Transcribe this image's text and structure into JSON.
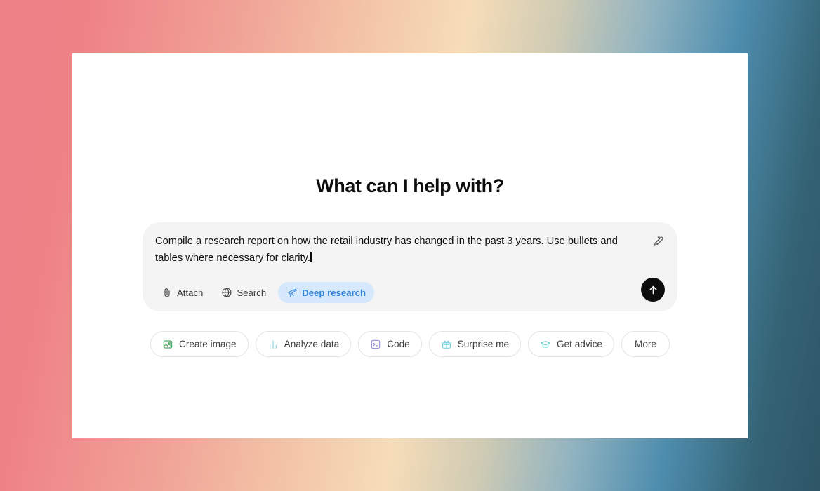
{
  "background": {
    "gradient_colors": [
      "#ef8288",
      "#f3c3a6",
      "#f6ddb8",
      "#90b3c0",
      "#4e8dae",
      "#2d5566"
    ]
  },
  "app": {
    "card_background": "#ffffff",
    "greeting": "What can I help with?"
  },
  "composer": {
    "background": "#f4f4f4",
    "text": "Compile a research report on how the retail industry has changed in the past 3 years. Use bullets and tables where necessary for clarity.",
    "caret_visible": true,
    "edit_icon": "pencil-sparkle-icon",
    "send_icon": "arrow-up-icon",
    "send_button_color": "#0d0d0d",
    "tools": [
      {
        "label": "Attach",
        "icon": "paperclip-icon",
        "active": false
      },
      {
        "label": "Search",
        "icon": "globe-icon",
        "active": false
      },
      {
        "label": "Deep research",
        "icon": "telescope-icon",
        "active": true,
        "active_bg": "#d6e8fb",
        "active_color": "#2f7fd4"
      }
    ]
  },
  "suggestions": [
    {
      "label": "Create image",
      "icon": "image-icon",
      "icon_color": "#49a962"
    },
    {
      "label": "Analyze data",
      "icon": "bar-chart-icon",
      "icon_color": "#8fd2e0"
    },
    {
      "label": "Code",
      "icon": "terminal-icon",
      "icon_color": "#8a8ad6"
    },
    {
      "label": "Surprise me",
      "icon": "gift-icon",
      "icon_color": "#7fd1de"
    },
    {
      "label": "Get advice",
      "icon": "graduation-cap-icon",
      "icon_color": "#66cfc4"
    },
    {
      "label": "More",
      "icon": null,
      "icon_color": null
    }
  ]
}
